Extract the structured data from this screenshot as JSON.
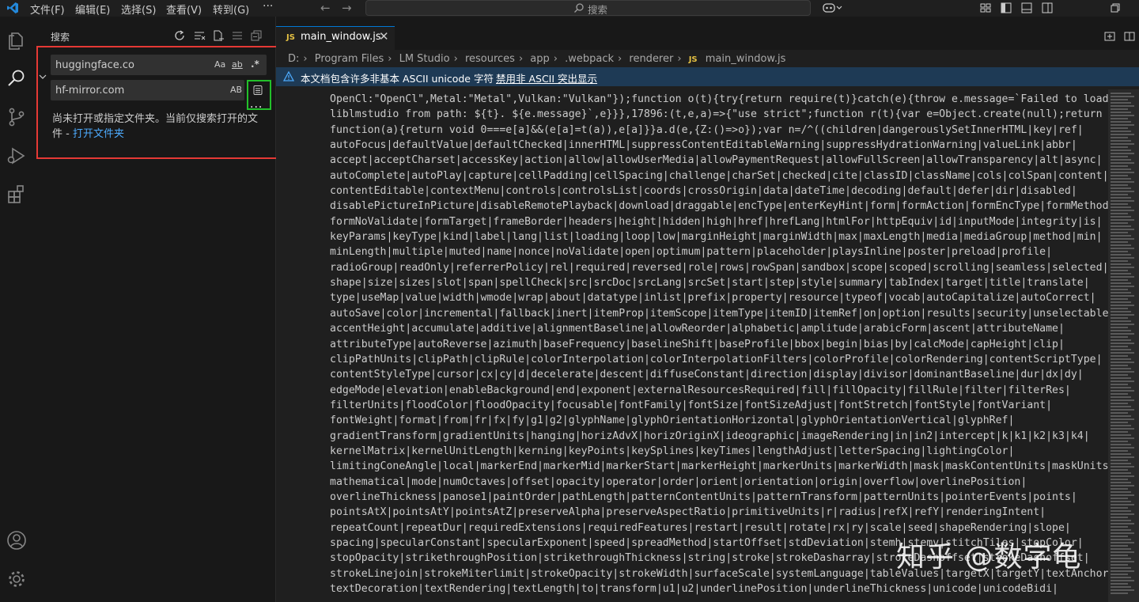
{
  "menu": [
    "文件(F)",
    "编辑(E)",
    "选择(S)",
    "查看(V)",
    "转到(G)"
  ],
  "menu_more": "···",
  "command_center": {
    "placeholder": "搜索"
  },
  "sidebar": {
    "title": "搜索",
    "search_value": "huggingface.co",
    "search_options": {
      "match_case": "Aa",
      "whole_word": "ab",
      "regex": ".*"
    },
    "replace_value": "hf-mirror.com",
    "replace_option": "AB",
    "more": "...",
    "message": "尚未打开或指定文件夹。当前仅搜索打开的文件 - ",
    "message_link": "打开文件夹"
  },
  "editor": {
    "tab_badge": "JS",
    "tab_name": "main_window.js",
    "tab_close": "✕",
    "breadcrumb": [
      "D:",
      "Program Files",
      "LM Studio",
      "resources",
      "app",
      ".webpack",
      "renderer"
    ],
    "breadcrumb_file": "main_window.js",
    "banner_message": "本文档包含许多非基本 ASCII unicode 字符",
    "banner_link": "禁用非 ASCII 突出显示",
    "code_lines": [
      "OpenCl:\"OpenCl\",Metal:\"Metal\",Vulkan:\"Vulkan\"});function o(t){try{return require(t)}catch(e){throw e.message=`Failed to load",
      "liblmstudio from path: ${t}. ${e.message}`,e}}},17896:(t,e,a)=>{\"use strict\";function r(t){var e=Object.create(null);return",
      "function(a){return void 0===e[a]&&(e[a]=t(a)),e[a]}}a.d(e,{Z:()=>o});var n=/^((children|dangerouslySetInnerHTML|key|ref|",
      "autoFocus|defaultValue|defaultChecked|innerHTML|suppressContentEditableWarning|suppressHydrationWarning|valueLink|abbr|",
      "accept|acceptCharset|accessKey|action|allow|allowUserMedia|allowPaymentRequest|allowFullScreen|allowTransparency|alt|async|",
      "autoComplete|autoPlay|capture|cellPadding|cellSpacing|challenge|charSet|checked|cite|classID|className|cols|colSpan|content|",
      "contentEditable|contextMenu|controls|controlsList|coords|crossOrigin|data|dateTime|decoding|default|defer|dir|disabled|",
      "disablePictureInPicture|disableRemotePlayback|download|draggable|encType|enterKeyHint|form|formAction|formEncType|formMethod|",
      "formNoValidate|formTarget|frameBorder|headers|height|hidden|high|href|hrefLang|htmlFor|httpEquiv|id|inputMode|integrity|is|",
      "keyParams|keyType|kind|label|lang|list|loading|loop|low|marginHeight|marginWidth|max|maxLength|media|mediaGroup|method|min|",
      "minLength|multiple|muted|name|nonce|noValidate|open|optimum|pattern|placeholder|playsInline|poster|preload|profile|",
      "radioGroup|readOnly|referrerPolicy|rel|required|reversed|role|rows|rowSpan|sandbox|scope|scoped|scrolling|seamless|selected|",
      "shape|size|sizes|slot|span|spellCheck|src|srcDoc|srcLang|srcSet|start|step|style|summary|tabIndex|target|title|translate|",
      "type|useMap|value|width|wmode|wrap|about|datatype|inlist|prefix|property|resource|typeof|vocab|autoCapitalize|autoCorrect|",
      "autoSave|color|incremental|fallback|inert|itemProp|itemScope|itemType|itemID|itemRef|on|option|results|security|unselectable|",
      "accentHeight|accumulate|additive|alignmentBaseline|allowReorder|alphabetic|amplitude|arabicForm|ascent|attributeName|",
      "attributeType|autoReverse|azimuth|baseFrequency|baselineShift|baseProfile|bbox|begin|bias|by|calcMode|capHeight|clip|",
      "clipPathUnits|clipPath|clipRule|colorInterpolation|colorInterpolationFilters|colorProfile|colorRendering|contentScriptType|",
      "contentStyleType|cursor|cx|cy|d|decelerate|descent|diffuseConstant|direction|display|divisor|dominantBaseline|dur|dx|dy|",
      "edgeMode|elevation|enableBackground|end|exponent|externalResourcesRequired|fill|fillOpacity|fillRule|filter|filterRes|",
      "filterUnits|floodColor|floodOpacity|focusable|fontFamily|fontSize|fontSizeAdjust|fontStretch|fontStyle|fontVariant|",
      "fontWeight|format|from|fr|fx|fy|g1|g2|glyphName|glyphOrientationHorizontal|glyphOrientationVertical|glyphRef|",
      "gradientTransform|gradientUnits|hanging|horizAdvX|horizOriginX|ideographic|imageRendering|in|in2|intercept|k|k1|k2|k3|k4|",
      "kernelMatrix|kernelUnitLength|kerning|keyPoints|keySplines|keyTimes|lengthAdjust|letterSpacing|lightingColor|",
      "limitingConeAngle|local|markerEnd|markerMid|markerStart|markerHeight|markerUnits|markerWidth|mask|maskContentUnits|maskUnits|",
      "mathematical|mode|numOctaves|offset|opacity|operator|order|orient|orientation|origin|overflow|overlinePosition|",
      "overlineThickness|panose1|paintOrder|pathLength|patternContentUnits|patternTransform|patternUnits|pointerEvents|points|",
      "pointsAtX|pointsAtY|pointsAtZ|preserveAlpha|preserveAspectRatio|primitiveUnits|r|radius|refX|refY|renderingIntent|",
      "repeatCount|repeatDur|requiredExtensions|requiredFeatures|restart|result|rotate|rx|ry|scale|seed|shapeRendering|slope|",
      "spacing|specularConstant|specularExponent|speed|spreadMethod|startOffset|stdDeviation|stemh|stemv|stitchTiles|stopColor|",
      "stopOpacity|strikethroughPosition|strikethroughThickness|string|stroke|strokeDasharray|strokeDashoffset|strokeDashoffset|",
      "strokeLinejoin|strokeMiterlimit|strokeOpacity|strokeWidth|surfaceScale|systemLanguage|tableValues|targetX|targetY|textAnchor|",
      "textDecoration|textRendering|textLength|to|transform|u1|u2|underlinePosition|underlineThickness|unicode|unicodeBidi|"
    ]
  },
  "watermark": "知乎 @数字龟",
  "colors": {
    "accent": "#0078d4",
    "link": "#4daafc",
    "highlight_red": "#e53935",
    "highlight_green": "#22c02a",
    "js_badge": "#e5c143"
  }
}
